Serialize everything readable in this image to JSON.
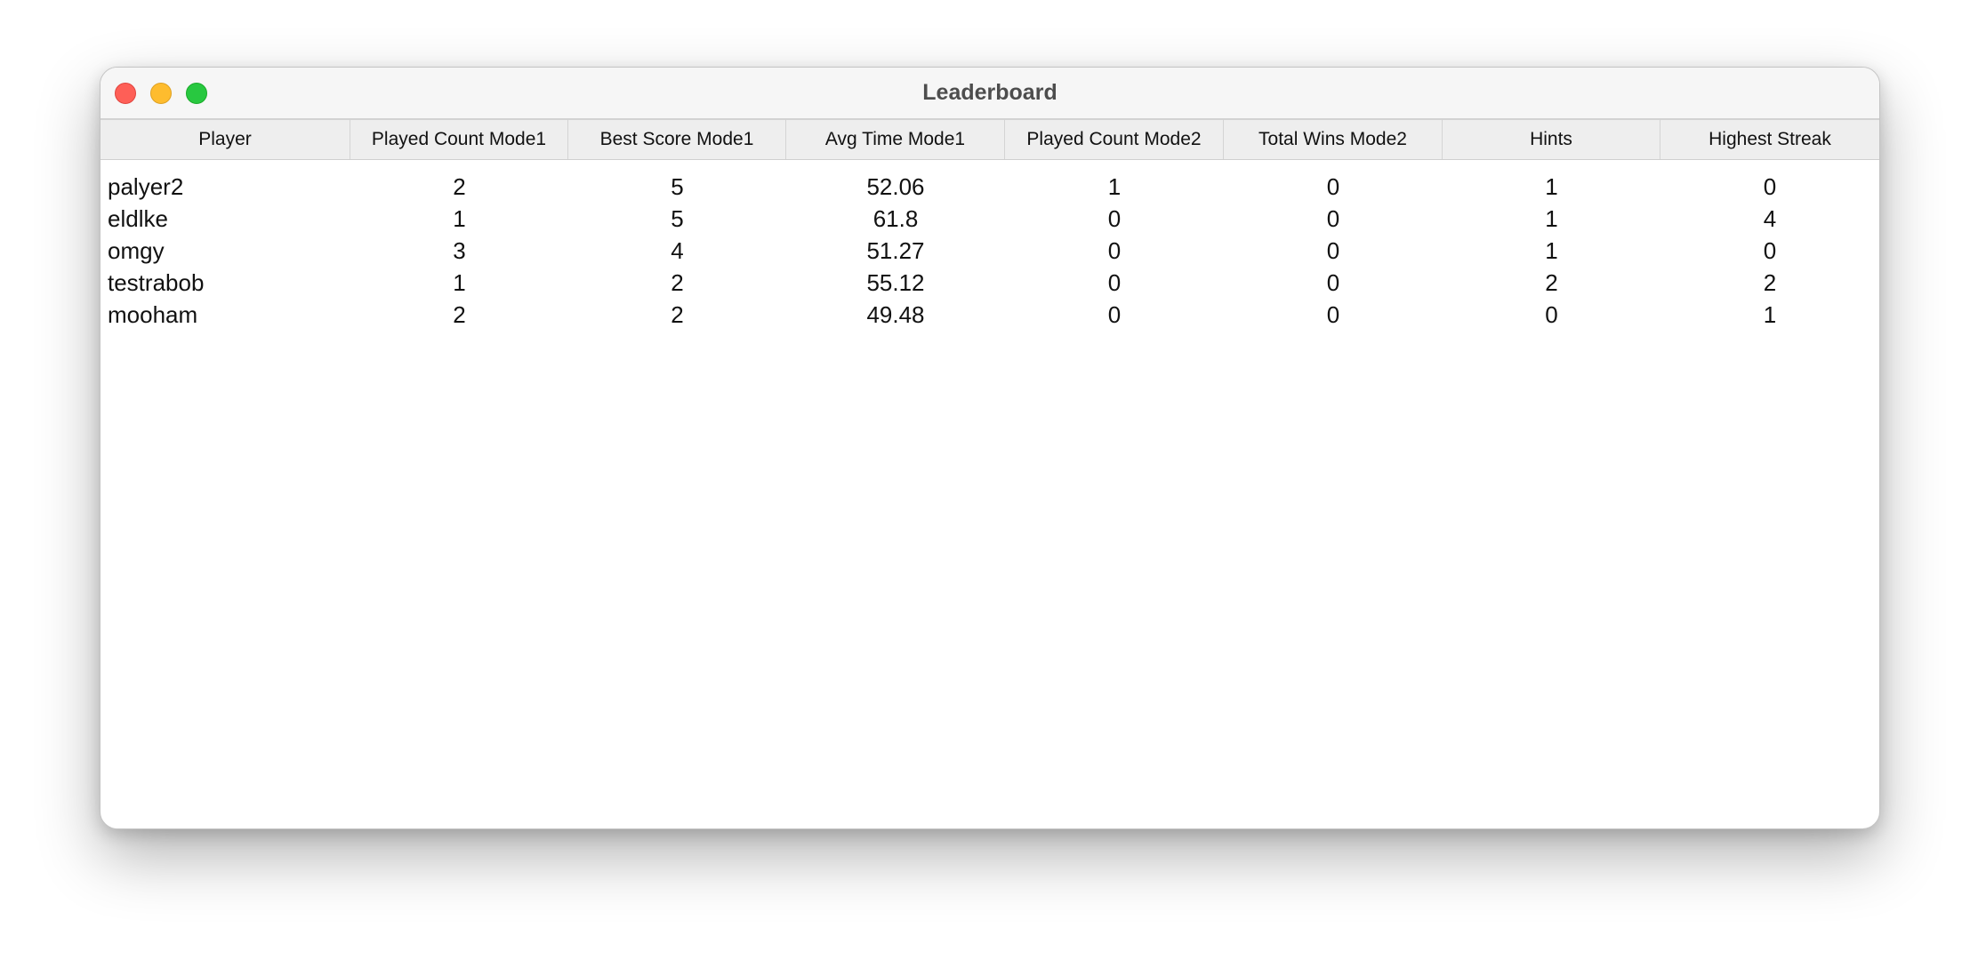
{
  "window": {
    "title": "Leaderboard"
  },
  "colors": {
    "close": "#fe5f57",
    "minimize": "#febc2e",
    "zoom": "#28c840",
    "header_bg": "#eeeeee"
  },
  "table": {
    "columns": [
      "Player",
      "Played Count Mode1",
      "Best Score Mode1",
      "Avg Time Mode1",
      "Played Count Mode2",
      "Total Wins Mode2",
      "Hints",
      "Highest Streak"
    ],
    "rows": [
      [
        "palyer2",
        "2",
        "5",
        "52.06",
        "1",
        "0",
        "1",
        "0"
      ],
      [
        "eldlke",
        "1",
        "5",
        "61.8",
        "0",
        "0",
        "1",
        "4"
      ],
      [
        "omgy",
        "3",
        "4",
        "51.27",
        "0",
        "0",
        "1",
        "0"
      ],
      [
        "testrabob",
        "1",
        "2",
        "55.12",
        "0",
        "0",
        "2",
        "2"
      ],
      [
        "mooham",
        "2",
        "2",
        "49.48",
        "0",
        "0",
        "0",
        "1"
      ]
    ]
  }
}
